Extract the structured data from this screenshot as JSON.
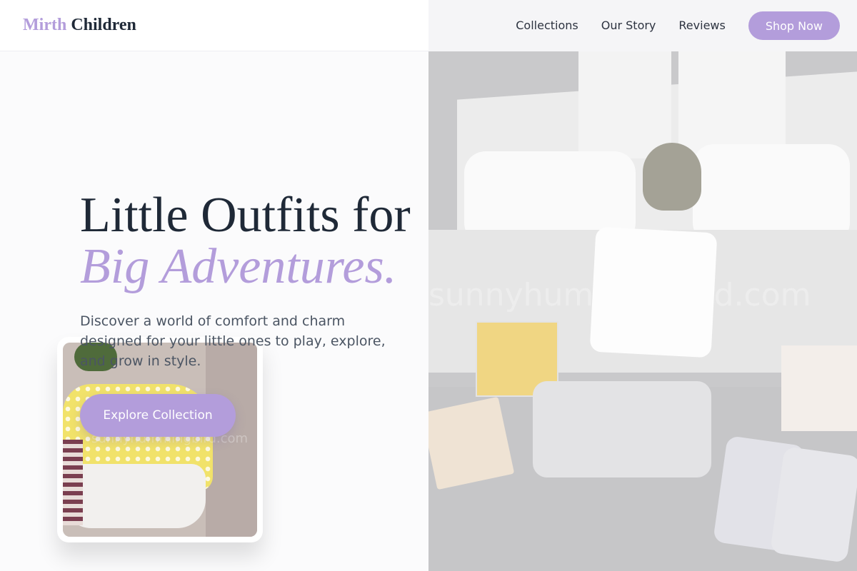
{
  "brand": {
    "name_accent": "Mirth",
    "name_rest": " Children",
    "accent_color": "#b39ddb",
    "text_color": "#1f2937"
  },
  "nav": {
    "links": [
      "Collections",
      "Our Story",
      "Reviews"
    ],
    "cta": "Shop Now"
  },
  "hero": {
    "title_line1": "Little Outfits for",
    "title_line2": "Big Adventures.",
    "subtitle": "Discover a world of comfort and charm designed for your little ones to play, explore, and grow in style.",
    "cta": "Explore Collection"
  },
  "images": {
    "hero_photo": {
      "description": "baby gift box with folded white clothes, plush toy, book, swaddles",
      "watermark": "sunnyhummingbird.com"
    },
    "card_photo": {
      "description": "rack of colorful children's dresses",
      "watermark": "sunnyhummingbird.com"
    }
  }
}
